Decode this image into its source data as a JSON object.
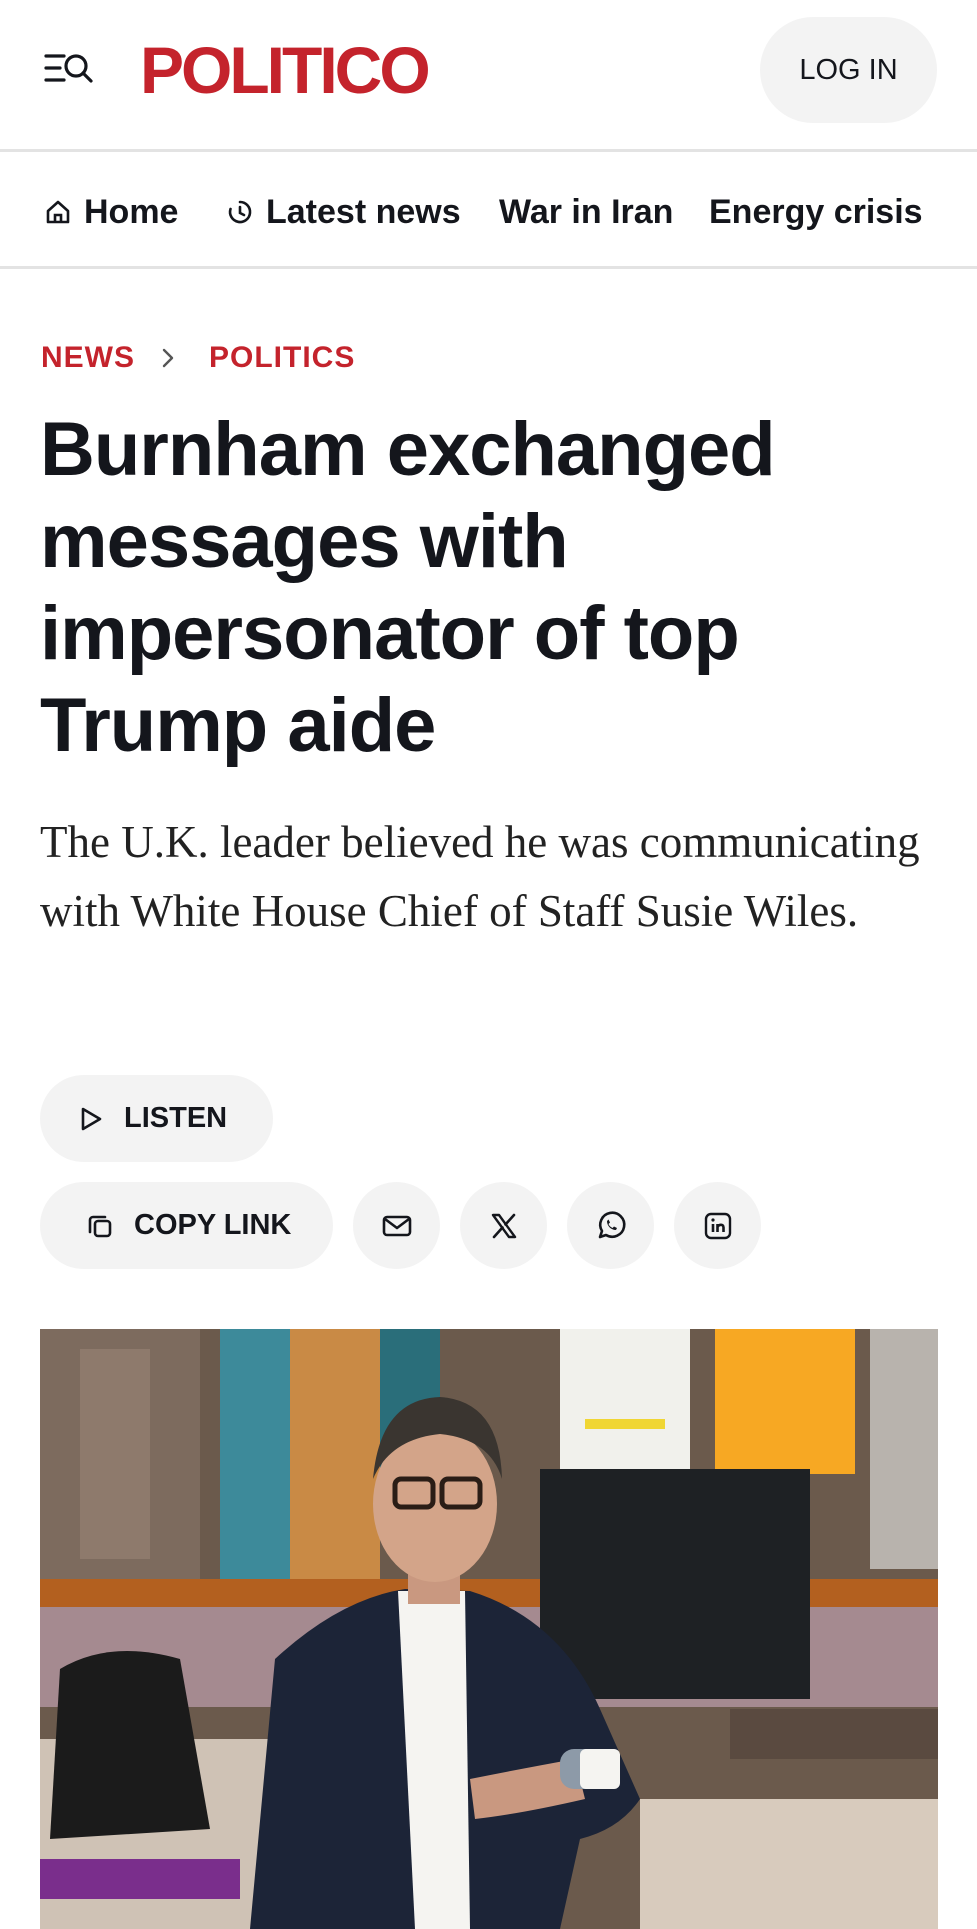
{
  "header": {
    "brand": "POLITICO",
    "login_label": "LOG IN"
  },
  "nav": {
    "items": [
      {
        "label": "Home",
        "icon": "home-icon"
      },
      {
        "label": "Latest news",
        "icon": "clock-icon"
      },
      {
        "label": "War in Iran"
      },
      {
        "label": "Energy crisis"
      }
    ]
  },
  "breadcrumb": {
    "section": "NEWS",
    "subsection": "POLITICS"
  },
  "article": {
    "headline": "Burnham exchanged messages with impersonator of top Trump aide",
    "dek": "The U.K. leader believed he was communicating with White House Chief of Staff Susie Wiles."
  },
  "actions": {
    "listen_label": "LISTEN",
    "copy_link_label": "COPY LINK",
    "share_icons": [
      "mail-icon",
      "x-icon",
      "whatsapp-icon",
      "linkedin-icon"
    ]
  },
  "colors": {
    "brand_red": "#c4232c",
    "text": "#14161c",
    "pill_bg": "#f3f3f3"
  }
}
